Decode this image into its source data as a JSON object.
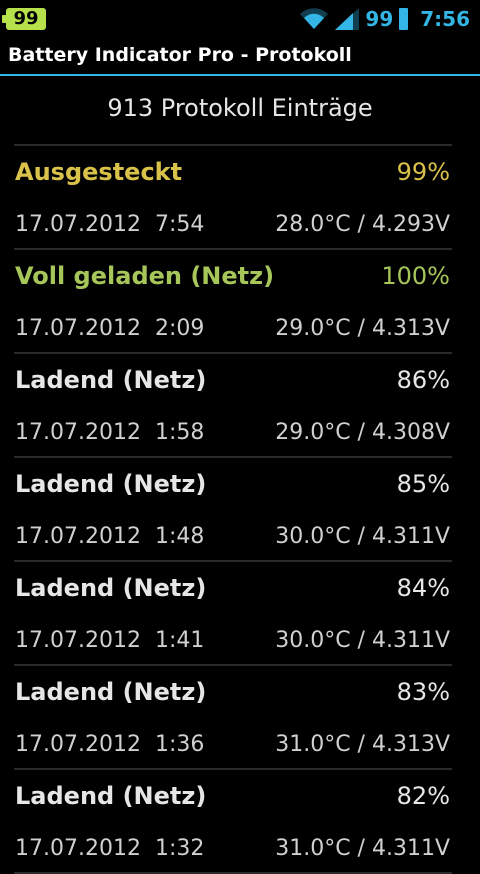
{
  "status_bar": {
    "battery_badge": "99",
    "battery_percent": "99",
    "time": "7:56",
    "accent_color": "#33b5e5",
    "badge_color": "#b7e14a",
    "icons": [
      "battery-badge-icon",
      "wifi-icon",
      "signal-icon",
      "battery-icon"
    ]
  },
  "title_bar": {
    "title": "Battery Indicator Pro - Protokoll"
  },
  "header": {
    "count_text": "913 Protokoll Einträge"
  },
  "entries": [
    {
      "status": "Ausgesteckt",
      "percent": "99%",
      "date": "17.07.2012  7:54",
      "measurement": "28.0°C / 4.293V",
      "color": "#d9c24a"
    },
    {
      "status": "Voll geladen (Netz)",
      "percent": "100%",
      "date": "17.07.2012  2:09",
      "measurement": "29.0°C / 4.313V",
      "color": "#a6c65a"
    },
    {
      "status": "Ladend (Netz)",
      "percent": "86%",
      "date": "17.07.2012  1:58",
      "measurement": "29.0°C / 4.308V",
      "color": "#e6e6e6"
    },
    {
      "status": "Ladend (Netz)",
      "percent": "85%",
      "date": "17.07.2012  1:48",
      "measurement": "30.0°C / 4.311V",
      "color": "#e6e6e6"
    },
    {
      "status": "Ladend (Netz)",
      "percent": "84%",
      "date": "17.07.2012  1:41",
      "measurement": "30.0°C / 4.311V",
      "color": "#e6e6e6"
    },
    {
      "status": "Ladend (Netz)",
      "percent": "83%",
      "date": "17.07.2012  1:36",
      "measurement": "31.0°C / 4.313V",
      "color": "#e6e6e6"
    },
    {
      "status": "Ladend (Netz)",
      "percent": "82%",
      "date": "17.07.2012  1:32",
      "measurement": "31.0°C / 4.311V",
      "color": "#e6e6e6"
    }
  ]
}
